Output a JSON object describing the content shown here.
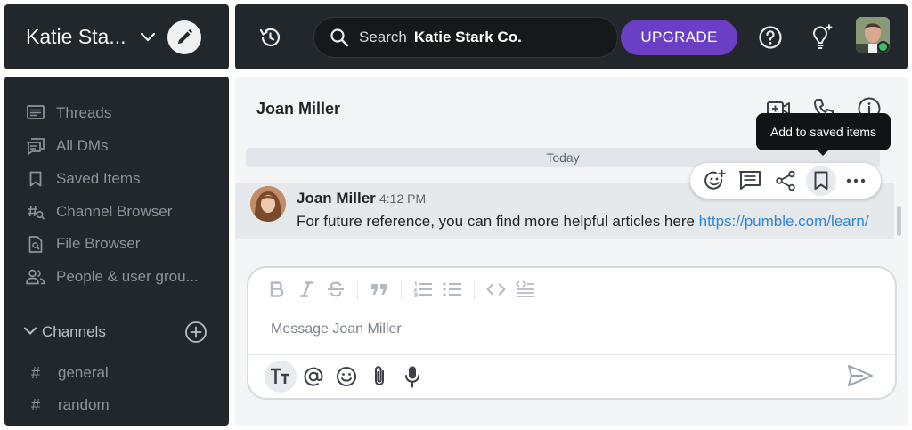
{
  "workspace": {
    "name": "Katie Sta..."
  },
  "topbar": {
    "search_prefix": "Search",
    "search_scope": "Katie Stark Co.",
    "upgrade_label": "UPGRADE"
  },
  "sidebar": {
    "items": [
      {
        "label": "Threads",
        "icon": "threads-icon"
      },
      {
        "label": "All DMs",
        "icon": "all-dms-icon"
      },
      {
        "label": "Saved Items",
        "icon": "bookmark-icon"
      },
      {
        "label": "Channel Browser",
        "icon": "channel-browser-icon"
      },
      {
        "label": "File Browser",
        "icon": "file-browser-icon"
      },
      {
        "label": "People & user grou...",
        "icon": "people-icon"
      }
    ],
    "channels_label": "Channels",
    "channels": [
      {
        "name": "general"
      },
      {
        "name": "random"
      }
    ]
  },
  "conversation": {
    "title": "Joan Miller",
    "date_divider": "Today",
    "message": {
      "author": "Joan Miller",
      "time": "4:12 PM",
      "text": "For future reference, you can find more helpful articles here ",
      "link": "https://pumble.com/learn/"
    },
    "tooltip": "Add to saved items"
  },
  "composer": {
    "placeholder": "Message Joan Miller"
  },
  "colors": {
    "accent": "#6a3fc6",
    "sidebar_bg": "#22272c",
    "link": "#2f86d6",
    "online": "#3fbf5b"
  }
}
